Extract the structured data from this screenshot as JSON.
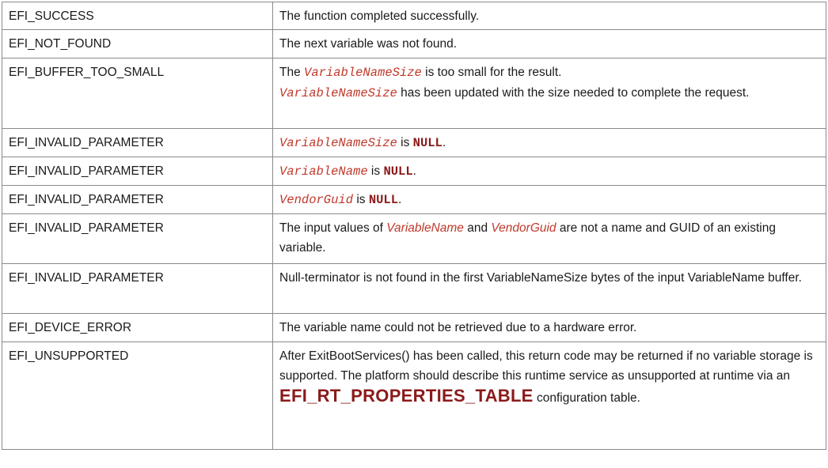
{
  "rows": [
    {
      "code": "EFI_SUCCESS",
      "desc": "The function completed successfully."
    },
    {
      "code": "EFI_NOT_FOUND",
      "desc": "The next variable was not found."
    },
    {
      "code": "EFI_BUFFER_TOO_SMALL",
      "desc": {
        "p1": "The ",
        "v1": "VariableNameSize",
        "p2": " is too small for the result.",
        "v2": "VariableNameSize",
        "p3": " has been updated with the size needed to complete the request."
      }
    },
    {
      "code": "EFI_INVALID_PARAMETER",
      "desc": {
        "v": "VariableNameSize",
        "mid": " is ",
        "null": "NULL",
        "end": "."
      }
    },
    {
      "code": "EFI_INVALID_PARAMETER",
      "desc": {
        "v": "VariableName",
        "mid": " is ",
        "null": "NULL",
        "end": "."
      }
    },
    {
      "code": "EFI_INVALID_PARAMETER",
      "desc": {
        "v": "VendorGuid",
        "mid": " is ",
        "null": "NULL",
        "end": "."
      }
    },
    {
      "code": "EFI_INVALID_PARAMETER",
      "desc": {
        "p1": "The input values of ",
        "v1": "VariableName",
        "p2": " and ",
        "v2": "VendorGuid",
        "p3": " are not a name and GUID of an existing variable."
      }
    },
    {
      "code": "EFI_INVALID_PARAMETER",
      "desc": "Null-terminator is not found in the first VariableNameSize bytes of the input VariableName buffer."
    },
    {
      "code": "EFI_DEVICE_ERROR",
      "desc": "The variable name could not be retrieved due to a hardware error."
    },
    {
      "code": "EFI_UNSUPPORTED",
      "desc": {
        "p1": "After ExitBootServices() has been called, this return code may be returned if no variable storage is supported. The platform should describe this runtime service as unsupported at runtime via an ",
        "table": "EFI_RT_PROPERTIES_TABLE",
        "p2": " configuration table."
      }
    }
  ]
}
